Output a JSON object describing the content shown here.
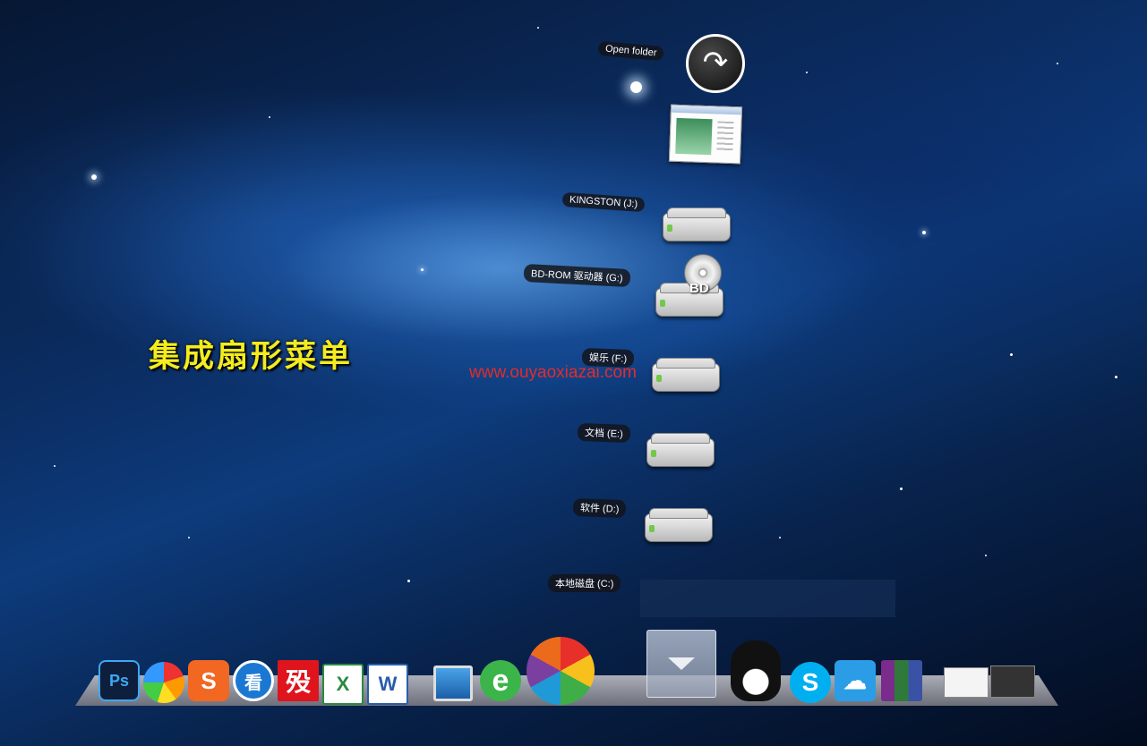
{
  "desktop": {
    "title": "集成扇形菜单",
    "watermark": "www.ouyaoxiazai.com"
  },
  "fan_menu": {
    "open_folder_label": "Open folder",
    "items": [
      {
        "label": "KINGSTON (J:)",
        "icon": "usb-drive-icon"
      },
      {
        "label": "BD-ROM 驱动器 (G:)",
        "icon": "bd-drive-icon"
      },
      {
        "label": "娱乐 (F:)",
        "icon": "hard-drive-icon"
      },
      {
        "label": "文档 (E:)",
        "icon": "hard-drive-icon"
      },
      {
        "label": "软件 (D:)",
        "icon": "hard-drive-icon"
      },
      {
        "label": "本地磁盘 (C:)",
        "icon": "hard-drive-icon"
      }
    ],
    "bd_badge": "BD"
  },
  "dock": {
    "icons": [
      {
        "name": "photoshop",
        "label": "Ps"
      },
      {
        "name": "color-balls",
        "label": ""
      },
      {
        "name": "sogou",
        "label": "S"
      },
      {
        "name": "kankan",
        "label": "看"
      },
      {
        "name": "game-red",
        "label": "殁"
      },
      {
        "name": "excel",
        "label": "X"
      },
      {
        "name": "word",
        "label": "W"
      },
      {
        "name": "computer",
        "label": ""
      },
      {
        "name": "ie",
        "label": "e"
      },
      {
        "name": "pinwheel",
        "label": ""
      },
      {
        "name": "qq",
        "label": ""
      },
      {
        "name": "skype",
        "label": "S"
      },
      {
        "name": "baidu-cloud",
        "label": ""
      },
      {
        "name": "winrar",
        "label": ""
      },
      {
        "name": "thumbnail-1",
        "label": ""
      },
      {
        "name": "thumbnail-2",
        "label": ""
      }
    ]
  }
}
